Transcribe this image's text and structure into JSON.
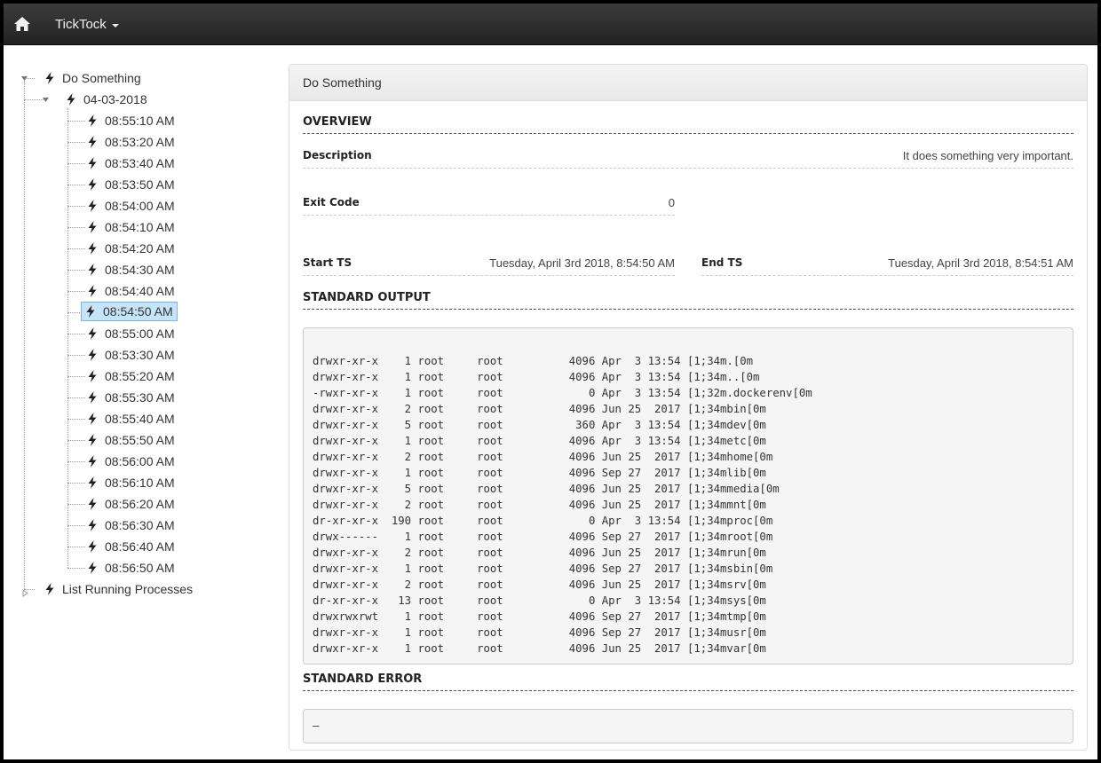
{
  "navbar": {
    "home_icon": "home-icon",
    "brand": "TickTock"
  },
  "tree": {
    "root_job": "Do Something",
    "date_node": "04-03-2018",
    "runs": [
      "08:55:10 AM",
      "08:53:20 AM",
      "08:53:40 AM",
      "08:53:50 AM",
      "08:54:00 AM",
      "08:54:10 AM",
      "08:54:20 AM",
      "08:54:30 AM",
      "08:54:40 AM",
      "08:54:50 AM",
      "08:55:00 AM",
      "08:53:30 AM",
      "08:55:20 AM",
      "08:55:30 AM",
      "08:55:40 AM",
      "08:55:50 AM",
      "08:56:00 AM",
      "08:56:10 AM",
      "08:56:20 AM",
      "08:56:30 AM",
      "08:56:40 AM",
      "08:56:50 AM"
    ],
    "selected_run": "08:54:50 AM",
    "second_job": "List Running Processes",
    "node_icon": "bolt-icon"
  },
  "panel": {
    "title": "Do Something",
    "overview_title": "OVERVIEW",
    "description_label": "Description",
    "description_value": "It does something very important.",
    "exit_code_label": "Exit Code",
    "exit_code_value": "0",
    "start_label": "Start TS",
    "start_value": "Tuesday, April 3rd 2018, 8:54:50 AM",
    "end_label": "End TS",
    "end_value": "Tuesday, April 3rd 2018, 8:54:51 AM",
    "stdout_title": "STANDARD OUTPUT",
    "stdout_lines": [
      "",
      "drwxr-xr-x    1 root     root          4096 Apr  3 13:54 [1;34m.[0m",
      "drwxr-xr-x    1 root     root          4096 Apr  3 13:54 [1;34m..[0m",
      "-rwxr-xr-x    1 root     root             0 Apr  3 13:54 [1;32m.dockerenv[0m",
      "drwxr-xr-x    2 root     root          4096 Jun 25  2017 [1;34mbin[0m",
      "drwxr-xr-x    5 root     root           360 Apr  3 13:54 [1;34mdev[0m",
      "drwxr-xr-x    1 root     root          4096 Apr  3 13:54 [1;34metc[0m",
      "drwxr-xr-x    2 root     root          4096 Jun 25  2017 [1;34mhome[0m",
      "drwxr-xr-x    1 root     root          4096 Sep 27  2017 [1;34mlib[0m",
      "drwxr-xr-x    5 root     root          4096 Jun 25  2017 [1;34mmedia[0m",
      "drwxr-xr-x    2 root     root          4096 Jun 25  2017 [1;34mmnt[0m",
      "dr-xr-xr-x  190 root     root             0 Apr  3 13:54 [1;34mproc[0m",
      "drwx------    1 root     root          4096 Sep 27  2017 [1;34mroot[0m",
      "drwxr-xr-x    2 root     root          4096 Jun 25  2017 [1;34mrun[0m",
      "drwxr-xr-x    1 root     root          4096 Sep 27  2017 [1;34msbin[0m",
      "drwxr-xr-x    2 root     root          4096 Jun 25  2017 [1;34msrv[0m",
      "dr-xr-xr-x   13 root     root             0 Apr  3 13:54 [1;34msys[0m",
      "drwxrwxrwt    1 root     root          4096 Sep 27  2017 [1;34mtmp[0m",
      "drwxr-xr-x    1 root     root          4096 Sep 27  2017 [1;34musr[0m",
      "drwxr-xr-x    1 root     root          4096 Jun 25  2017 [1;34mvar[0m"
    ],
    "stderr_title": "STANDARD ERROR",
    "stderr_text": "–"
  }
}
